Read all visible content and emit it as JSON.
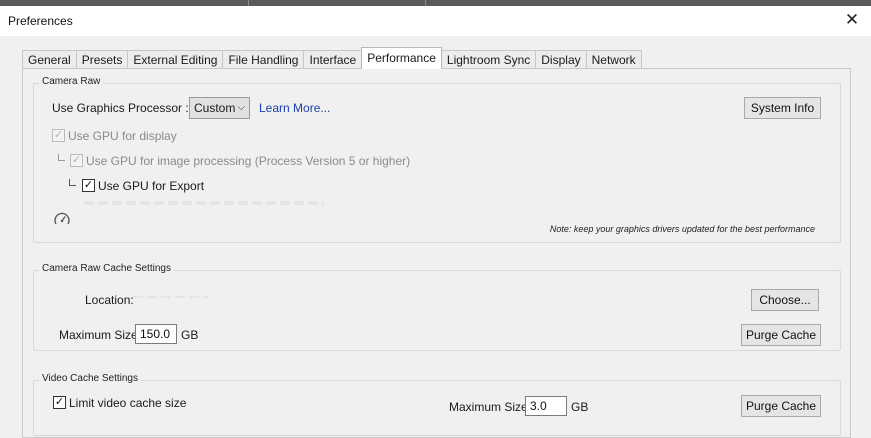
{
  "window": {
    "title": "Preferences",
    "close_glyph": "✕"
  },
  "tabs": [
    {
      "label": "General",
      "active": false
    },
    {
      "label": "Presets",
      "active": false
    },
    {
      "label": "External Editing",
      "active": false
    },
    {
      "label": "File Handling",
      "active": false
    },
    {
      "label": "Interface",
      "active": false
    },
    {
      "label": "Performance",
      "active": true
    },
    {
      "label": "Lightroom Sync",
      "active": false
    },
    {
      "label": "Display",
      "active": false
    },
    {
      "label": "Network",
      "active": false
    }
  ],
  "camera_raw": {
    "legend": "Camera Raw",
    "gpu_label": "Use Graphics Processor :",
    "gpu_value": "Custom",
    "learn_more": "Learn More...",
    "system_info": "System Info",
    "use_gpu_display": {
      "label": "Use GPU for display",
      "checked": true,
      "enabled": false
    },
    "use_gpu_processing": {
      "label": "Use GPU for image processing (Process Version 5 or higher)",
      "checked": true,
      "enabled": false
    },
    "use_gpu_export": {
      "label": "Use GPU for Export",
      "checked": true,
      "enabled": true
    },
    "gauge_icon": "gauge-icon",
    "note": "Note: keep your graphics drivers updated for the best performance"
  },
  "cache": {
    "legend": "Camera Raw Cache Settings",
    "location_label": "Location:",
    "choose": "Choose...",
    "max_size_label": "Maximum Size:",
    "max_size_value": "150.0",
    "unit": "GB",
    "purge": "Purge Cache"
  },
  "video_cache": {
    "legend": "Video Cache Settings",
    "limit": {
      "label": "Limit video cache size",
      "checked": true
    },
    "max_size_label": "Maximum Size:",
    "max_size_value": "3.0",
    "unit": "GB",
    "purge": "Purge Cache"
  },
  "check_glyph": "✓",
  "dropdown_glyph": "⌵"
}
